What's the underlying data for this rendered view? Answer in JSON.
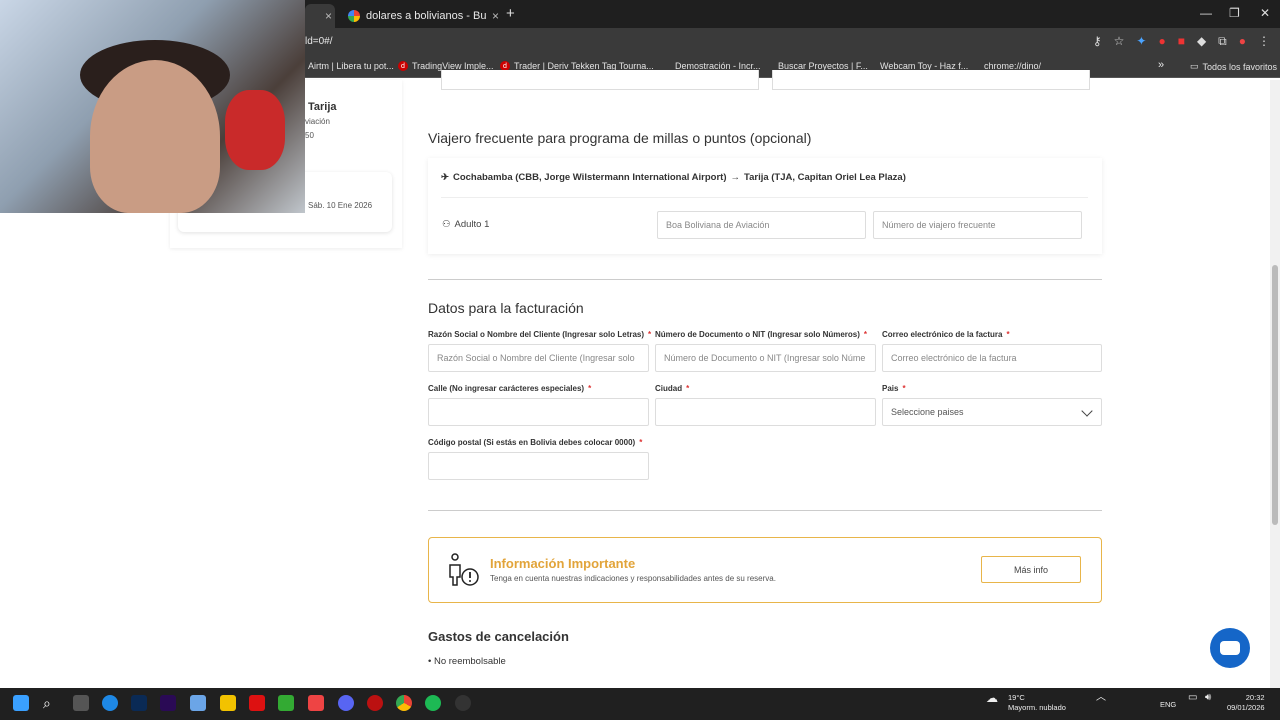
{
  "browser": {
    "tab_active_close": "×",
    "tab2_title": "dolares a bolivianos - Buscar co",
    "tab2_close": "×",
    "new_tab": "+",
    "url": "ld=0#/",
    "bookmarks": [
      "Airtm | Libera tu pot...",
      "TradingView Imple...",
      "Trader | Deriv",
      "Tekken Tag Tourna...",
      "Demostración - Incr...",
      "Buscar Proyectos | F...",
      "Webcam Toy - Haz f...",
      "chrome://dino/"
    ],
    "bookmarks_more": "»",
    "all_bookmarks": "Todos los favoritos"
  },
  "left_summary": {
    "city": "Tarija",
    "airline_fragment": "viación",
    "price_fragment": "50",
    "date": "Sáb. 10 Ene 2026"
  },
  "frequent_flyer": {
    "title": "Viajero frecuente para programa de millas o puntos (opcional)",
    "route_origin": "Cochabamba (CBB, Jorge Wilstermann International Airport)",
    "route_arrow": "→",
    "route_destination": "Tarija (TJA, Capitan Oriel Lea Plaza)",
    "passenger": "Adulto 1",
    "airline_value": "Boa Boliviana de Aviación",
    "number_placeholder": "Número de viajero frecuente"
  },
  "billing": {
    "title": "Datos para la facturación",
    "name_label": "Razón Social o Nombre del Cliente (Ingresar solo Letras)",
    "name_placeholder": "Razón Social o Nombre del Cliente (Ingresar solo",
    "doc_label": "Número de Documento o NIT (Ingresar solo Números)",
    "doc_placeholder": "Número de Documento o NIT (Ingresar solo Núme",
    "email_label": "Correo electrónico de la factura",
    "email_placeholder": "Correo electrónico de la factura",
    "street_label": "Calle (No ingresar carácteres especiales)",
    "city_label": "Ciudad",
    "country_label": "Pais",
    "country_value": "Seleccione paises",
    "zip_label": "Código postal (Si estás en Bolivia debes colocar 0000)",
    "required_mark": "*"
  },
  "important": {
    "title": "Información Importante",
    "text": "Tenga en cuenta nuestras indicaciones y responsabilidades antes de su reserva.",
    "button": "Más info"
  },
  "cancellation": {
    "title": "Gastos de cancelación",
    "item": "• No reembolsable"
  },
  "taskbar": {
    "temp": "19°C",
    "weather": "Mayorm. nublado",
    "lang": "ENG",
    "time": "20:32",
    "date": "09/01/2026"
  },
  "colors": {
    "accent": "#e8b54a",
    "chat": "#1566c8"
  }
}
